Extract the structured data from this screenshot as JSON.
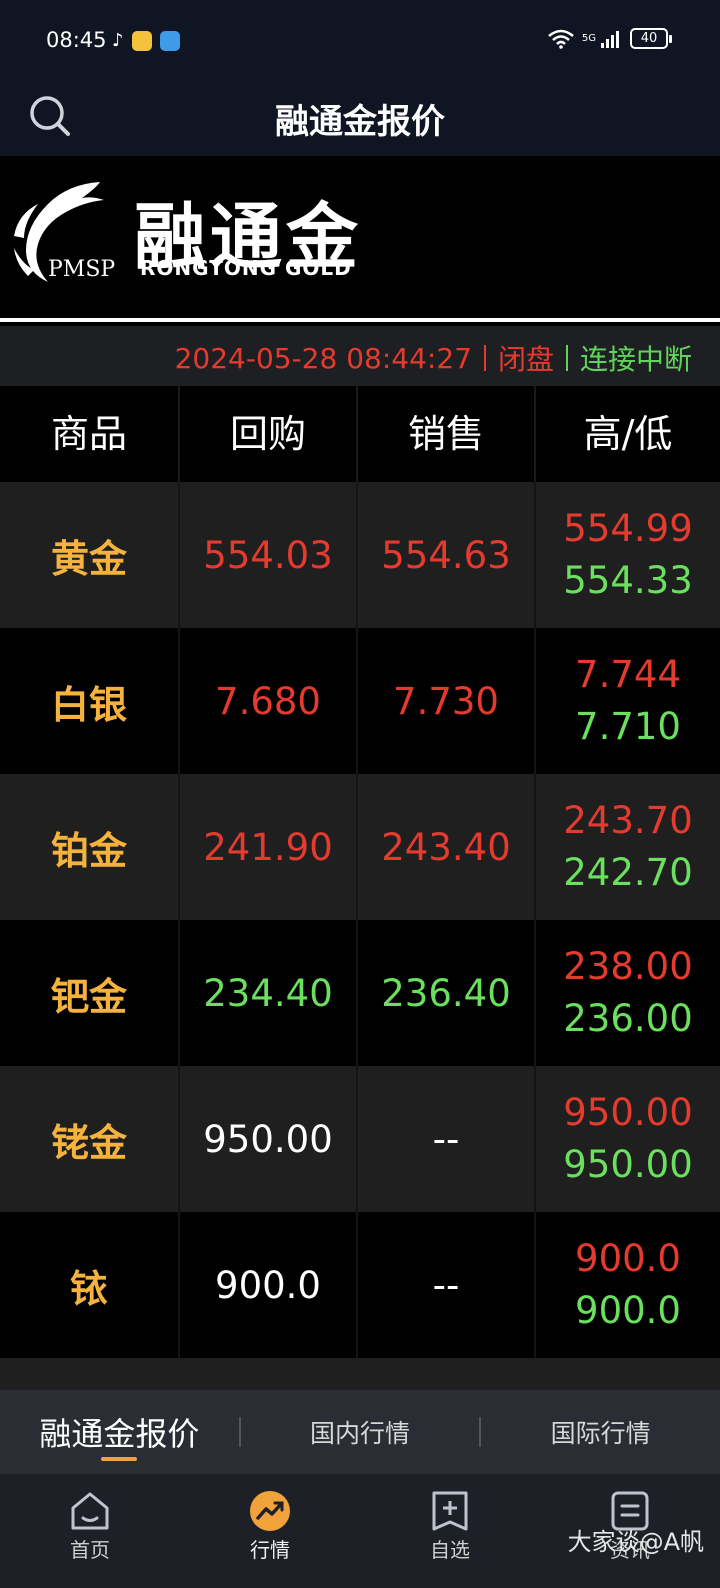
{
  "status_bar": {
    "time": "08:45",
    "network": "5G",
    "battery": "40"
  },
  "header": {
    "title": "融通金报价"
  },
  "banner": {
    "brand_cn": "融通金",
    "brand_en": "RONGTONG GOLD",
    "brand_abbr": "PMSP"
  },
  "status_line": {
    "datetime": "2024-05-28 08:44:27",
    "market_state": "闭盘",
    "connection": "连接中断"
  },
  "table": {
    "headers": [
      "商品",
      "回购",
      "销售",
      "高/低"
    ],
    "rows": [
      {
        "name": "黄金",
        "buyback": "554.03",
        "sell": "554.63",
        "high": "554.99",
        "low": "554.33",
        "buyback_color": "red",
        "sell_color": "red"
      },
      {
        "name": "白银",
        "buyback": "7.680",
        "sell": "7.730",
        "high": "7.744",
        "low": "7.710",
        "buyback_color": "red",
        "sell_color": "red"
      },
      {
        "name": "铂金",
        "buyback": "241.90",
        "sell": "243.40",
        "high": "243.70",
        "low": "242.70",
        "buyback_color": "red",
        "sell_color": "red"
      },
      {
        "name": "钯金",
        "buyback": "234.40",
        "sell": "236.40",
        "high": "238.00",
        "low": "236.00",
        "buyback_color": "green",
        "sell_color": "green"
      },
      {
        "name": "铑金",
        "buyback": "950.00",
        "sell": "--",
        "high": "950.00",
        "low": "950.00",
        "buyback_color": "white",
        "sell_color": "white"
      },
      {
        "name": "铱",
        "buyback": "900.0",
        "sell": "--",
        "high": "900.0",
        "low": "900.0",
        "buyback_color": "white",
        "sell_color": "white"
      }
    ]
  },
  "sub_tabs": {
    "items": [
      "融通金报价",
      "国内行情",
      "国际行情"
    ],
    "active": "融通金报价"
  },
  "bottom_nav": {
    "items": [
      {
        "label": "首页",
        "icon": "home-icon"
      },
      {
        "label": "行情",
        "icon": "market-trend-icon"
      },
      {
        "label": "自选",
        "icon": "add-favorite-icon"
      },
      {
        "label": "资讯",
        "icon": "news-icon"
      }
    ],
    "active": "行情"
  },
  "watermark": "大家谈@A帆",
  "colors": {
    "up_red": "#e53b2f",
    "down_green": "#6ae05e",
    "product_gold": "#f5b33e",
    "accent_orange": "#f2a23a",
    "header_bg": "#0f1522"
  }
}
